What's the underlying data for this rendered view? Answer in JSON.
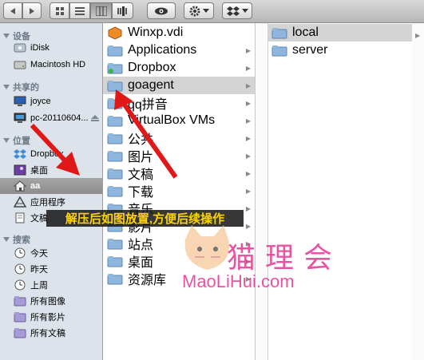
{
  "toolbar": {
    "back_icon": "back-arrow-icon",
    "forward_icon": "forward-arrow-icon",
    "view_buttons": [
      "icon-view-icon",
      "list-view-icon",
      "column-view-icon",
      "coverflow-view-icon"
    ],
    "quicklook_icon": "eye-icon",
    "action_icon": "gear-icon",
    "dropbox_icon": "dropbox-icon"
  },
  "sidebar": {
    "devices_title": "设备",
    "devices": [
      "iDisk",
      "Macintosh HD"
    ],
    "shared_title": "共享的",
    "shared": [
      "joyce",
      "pc-20110604..."
    ],
    "places_title": "位置",
    "places": [
      "Dropbox",
      "桌面",
      "aa",
      "应用程序",
      "文稿"
    ],
    "search_title": "搜索",
    "search": [
      "今天",
      "昨天",
      "上周",
      "所有图像",
      "所有影片",
      "所有文稿"
    ]
  },
  "column1": [
    "Winxp.vdi",
    "Applications",
    "Dropbox",
    "goagent",
    "qq拼音",
    "VirtualBox VMs",
    "公共",
    "图片",
    "文稿",
    "下载",
    "音乐",
    "影片",
    "站点",
    "桌面",
    "资源库"
  ],
  "column2": [
    "local",
    "server"
  ],
  "annotation": {
    "banner": "解压后如图放置,方便后续操作",
    "watermark_cn": "猫理会",
    "watermark_en": "MaoLiHui.com"
  },
  "colors": {
    "banner_text": "#ffd400",
    "watermark": "#e6419a",
    "arrow": "#e01818"
  }
}
